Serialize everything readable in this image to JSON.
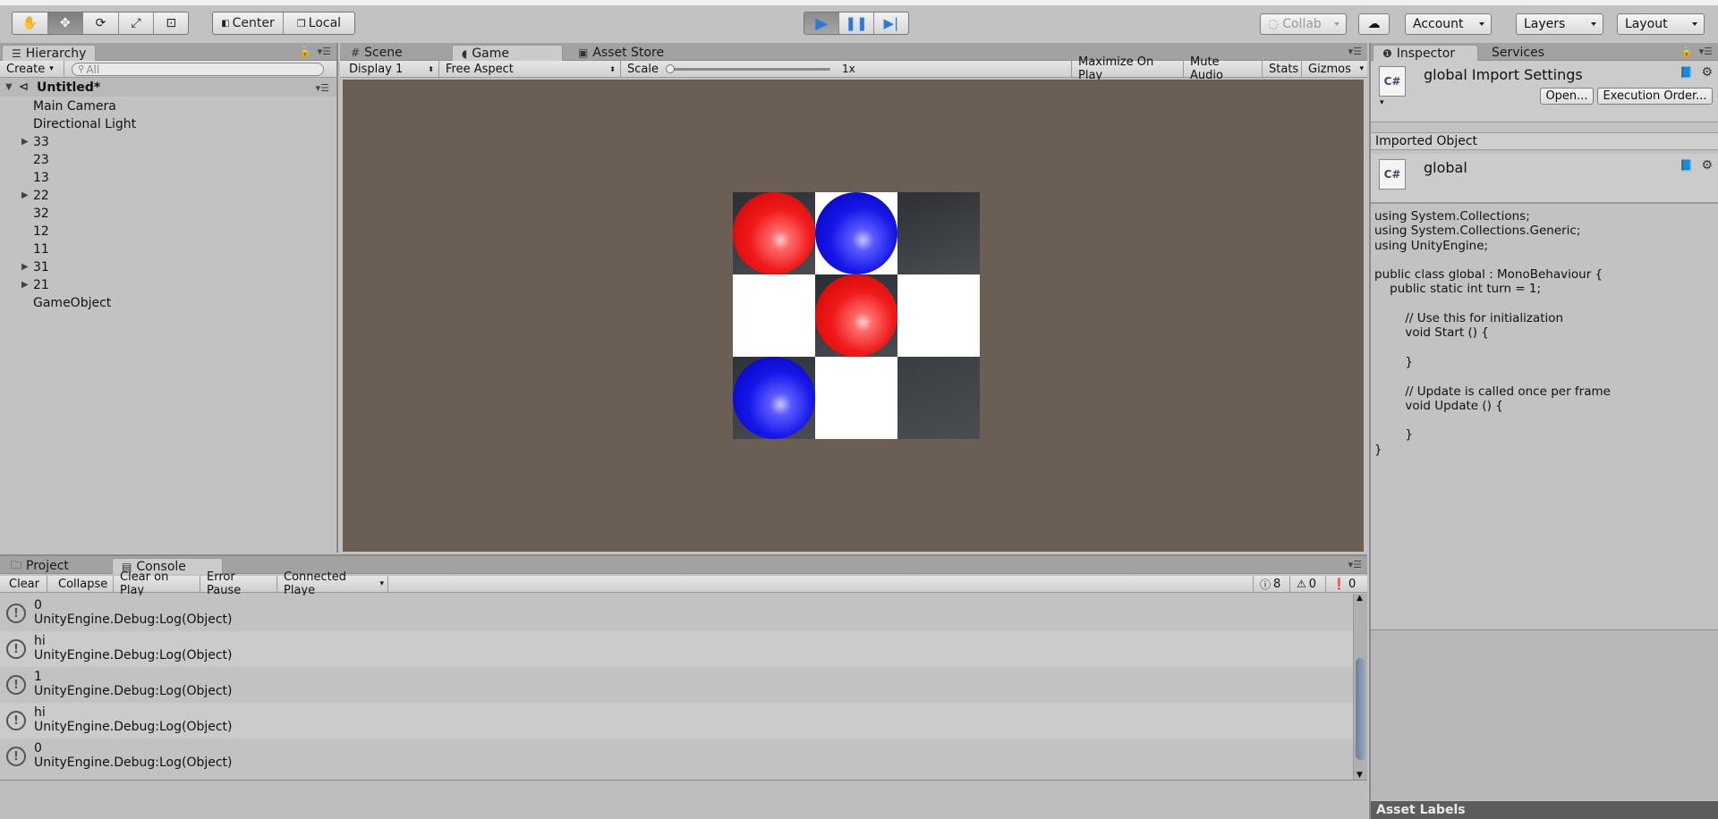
{
  "toolbar": {
    "pivot_label": "Center",
    "space_label": "Local",
    "collab_label": "Collab",
    "account_label": "Account",
    "layers_label": "Layers",
    "layout_label": "Layout"
  },
  "hierarchy": {
    "tab_label": "Hierarchy",
    "create_label": "Create",
    "search_placeholder": "All",
    "scene_name": "Untitled*",
    "items": [
      {
        "label": "Main Camera",
        "expandable": false
      },
      {
        "label": "Directional Light",
        "expandable": false
      },
      {
        "label": "33",
        "expandable": true
      },
      {
        "label": "23",
        "expandable": false
      },
      {
        "label": "13",
        "expandable": false
      },
      {
        "label": "22",
        "expandable": true
      },
      {
        "label": "32",
        "expandable": false
      },
      {
        "label": "12",
        "expandable": false
      },
      {
        "label": "11",
        "expandable": false
      },
      {
        "label": "31",
        "expandable": true
      },
      {
        "label": "21",
        "expandable": true
      },
      {
        "label": "GameObject",
        "expandable": false
      }
    ]
  },
  "center_tabs": {
    "scene": "Scene",
    "game": "Game",
    "asset_store": "Asset Store"
  },
  "game_bar": {
    "display": "Display 1",
    "aspect": "Free Aspect",
    "scale_label": "Scale",
    "scale_value": "1x",
    "maximize": "Maximize On Play",
    "mute": "Mute Audio",
    "stats": "Stats",
    "gizmos": "Gizmos"
  },
  "board": {
    "cells": [
      {
        "color": "#2b2e33",
        "piece": "red"
      },
      {
        "color": "#ffffff",
        "piece": "blue"
      },
      {
        "color": "#2d3035",
        "piece": null
      },
      {
        "color": "#ffffff",
        "piece": null
      },
      {
        "color": "#2a2d32",
        "piece": "red"
      },
      {
        "color": "#ffffff",
        "piece": null
      },
      {
        "color": "#2f3237",
        "piece": "blue"
      },
      {
        "color": "#ffffff",
        "piece": null
      },
      {
        "color": "#3a3d42",
        "piece": null
      }
    ]
  },
  "inspector": {
    "tab_label": "Inspector",
    "services_label": "Services",
    "title": "global Import Settings",
    "open_btn": "Open...",
    "exec_btn": "Execution Order...",
    "imported_header": "Imported Object",
    "object_name": "global",
    "code": "using System.Collections;\nusing System.Collections.Generic;\nusing UnityEngine;\n\npublic class global : MonoBehaviour {\n    public static int turn = 1;\n\n\t// Use this for initialization\n\tvoid Start () {\n\t\t\n\t}\n\t\n\t// Update is called once per frame\n\tvoid Update () {\n\t\t\n\t}\n}",
    "asset_labels": "Asset Labels"
  },
  "console": {
    "project_tab": "Project",
    "console_tab": "Console",
    "clear": "Clear",
    "collapse": "Collapse",
    "clear_on_play": "Clear on Play",
    "error_pause": "Error Pause",
    "connected": "Connected Playe",
    "log_count": "8",
    "warn_count": "0",
    "error_count": "0",
    "entries": [
      {
        "msg": "0",
        "trace": "UnityEngine.Debug:Log(Object)"
      },
      {
        "msg": "hi",
        "trace": "UnityEngine.Debug:Log(Object)"
      },
      {
        "msg": "1",
        "trace": "UnityEngine.Debug:Log(Object)"
      },
      {
        "msg": "hi",
        "trace": "UnityEngine.Debug:Log(Object)"
      },
      {
        "msg": "0",
        "trace": "UnityEngine.Debug:Log(Object)"
      }
    ]
  },
  "colors": {
    "game_bg": "#6a5e55",
    "red_piece": "#ff3b3b",
    "blue_piece": "#2222e0"
  }
}
